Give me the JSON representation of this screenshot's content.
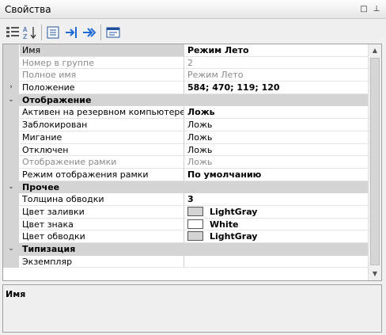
{
  "window": {
    "title": "Свойства",
    "restore_glyph": "□",
    "pin_glyph": "⊥"
  },
  "toolbar": {
    "items": [
      {
        "name": "categorized-view-icon"
      },
      {
        "name": "sort-alphabetical-icon"
      },
      {
        "name": "property-pages-icon"
      },
      {
        "name": "go-to-definition-icon"
      },
      {
        "name": "go-to-next-icon"
      },
      {
        "name": "properties-window-icon"
      }
    ]
  },
  "grid": {
    "rows": [
      {
        "type": "prop",
        "name": "Имя",
        "value": "Режим Лето",
        "bold": true,
        "selected": true
      },
      {
        "type": "prop",
        "name": "Номер в группе",
        "value": "2",
        "gray": true
      },
      {
        "type": "prop",
        "name": "Полное имя",
        "value": "Режим Лето",
        "gray": true
      },
      {
        "type": "prop",
        "name": "Положение",
        "value": "584; 470; 119; 120",
        "bold": true,
        "expander": "›"
      },
      {
        "type": "category",
        "name": "Отображение",
        "expander": "⌄"
      },
      {
        "type": "prop",
        "name": "Активен на резервном компьютере",
        "value": "Ложь",
        "bold": true
      },
      {
        "type": "prop",
        "name": "Заблокирован",
        "value": "Ложь"
      },
      {
        "type": "prop",
        "name": "Мигание",
        "value": "Ложь"
      },
      {
        "type": "prop",
        "name": "Отключен",
        "value": "Ложь"
      },
      {
        "type": "prop",
        "name": "Отображение рамки",
        "value": "Ложь",
        "gray": true
      },
      {
        "type": "prop",
        "name": "Режим отображения рамки",
        "value": "По умолчанию",
        "bold": true
      },
      {
        "type": "category",
        "name": "Прочее",
        "expander": "⌄"
      },
      {
        "type": "prop",
        "name": "Толщина обводки",
        "value": "3",
        "bold": true
      },
      {
        "type": "prop",
        "name": "Цвет заливки",
        "value": "LightGray",
        "bold": true,
        "swatch": "#d3d3d3"
      },
      {
        "type": "prop",
        "name": "Цвет знака",
        "value": "White",
        "bold": true,
        "swatch": "#ffffff"
      },
      {
        "type": "prop",
        "name": "Цвет обводки",
        "value": "LightGray",
        "bold": true,
        "swatch": "#d3d3d3"
      },
      {
        "type": "category",
        "name": "Типизация",
        "expander": "⌄"
      },
      {
        "type": "prop",
        "name": "Экземпляр",
        "value": ""
      }
    ]
  },
  "scrollbar": {
    "up_glyph": "▲",
    "down_glyph": "▼"
  },
  "description": {
    "title": "Имя"
  }
}
